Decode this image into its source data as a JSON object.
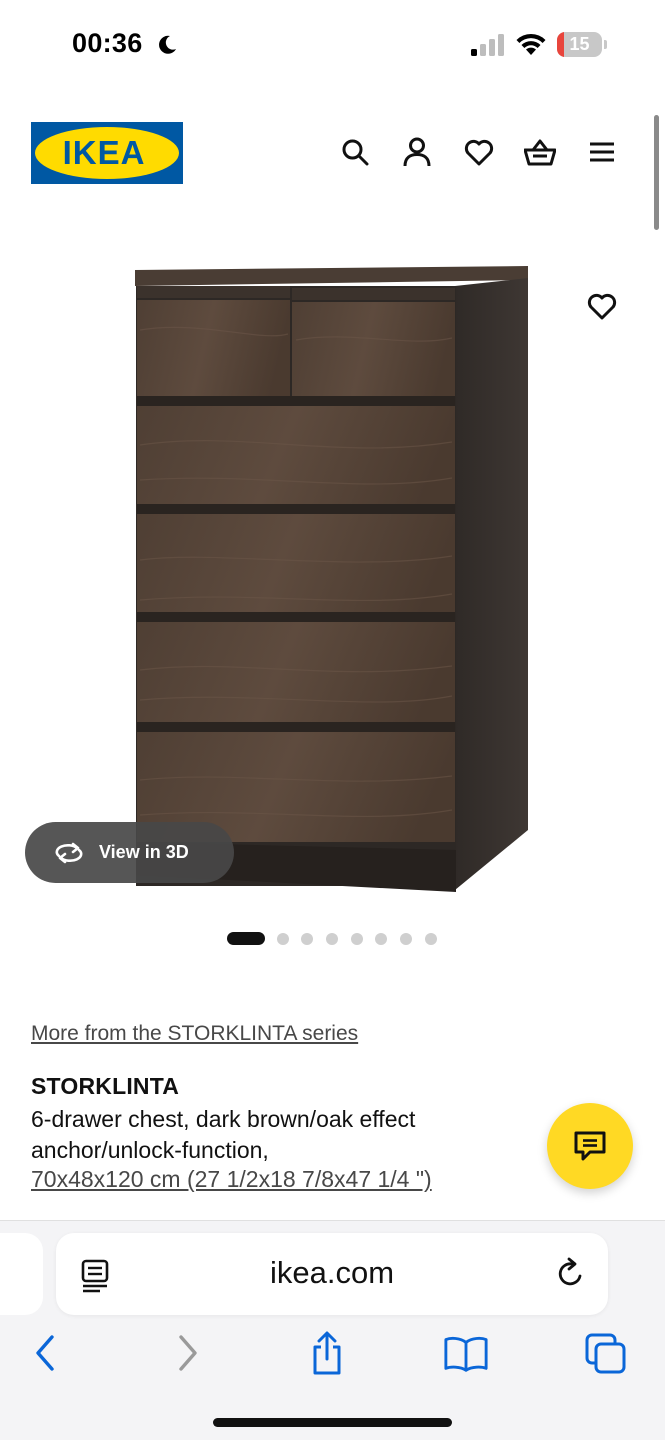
{
  "status_bar": {
    "time": "00:36",
    "battery_level": "15",
    "battery_color": "#e8453c"
  },
  "header": {
    "logo_text": "IKEA",
    "logo_colors": {
      "blue": "#0058a3",
      "yellow": "#ffdb00"
    },
    "icons": [
      "search-icon",
      "account-icon",
      "heart-icon",
      "basket-icon",
      "menu-icon"
    ]
  },
  "gallery": {
    "view3d_label": "View in 3D",
    "image_count": 8,
    "active_index": 0
  },
  "product": {
    "series_link": "More from the STORKLINTA series",
    "name": "STORKLINTA",
    "description_line1": "6-drawer chest, dark brown/oak effect",
    "description_line2": "anchor/unlock-function,",
    "dimensions": "70x48x120 cm (27 1/2x18 7/8x47 1/4 \")"
  },
  "chat": {
    "color": "#ffd924",
    "icon": "chat-icon"
  },
  "browser": {
    "url": "ikea.com",
    "accent": "#0a66d8",
    "nav_icons": [
      "back-icon",
      "forward-icon",
      "share-icon",
      "bookmarks-icon",
      "tabs-icon"
    ]
  }
}
